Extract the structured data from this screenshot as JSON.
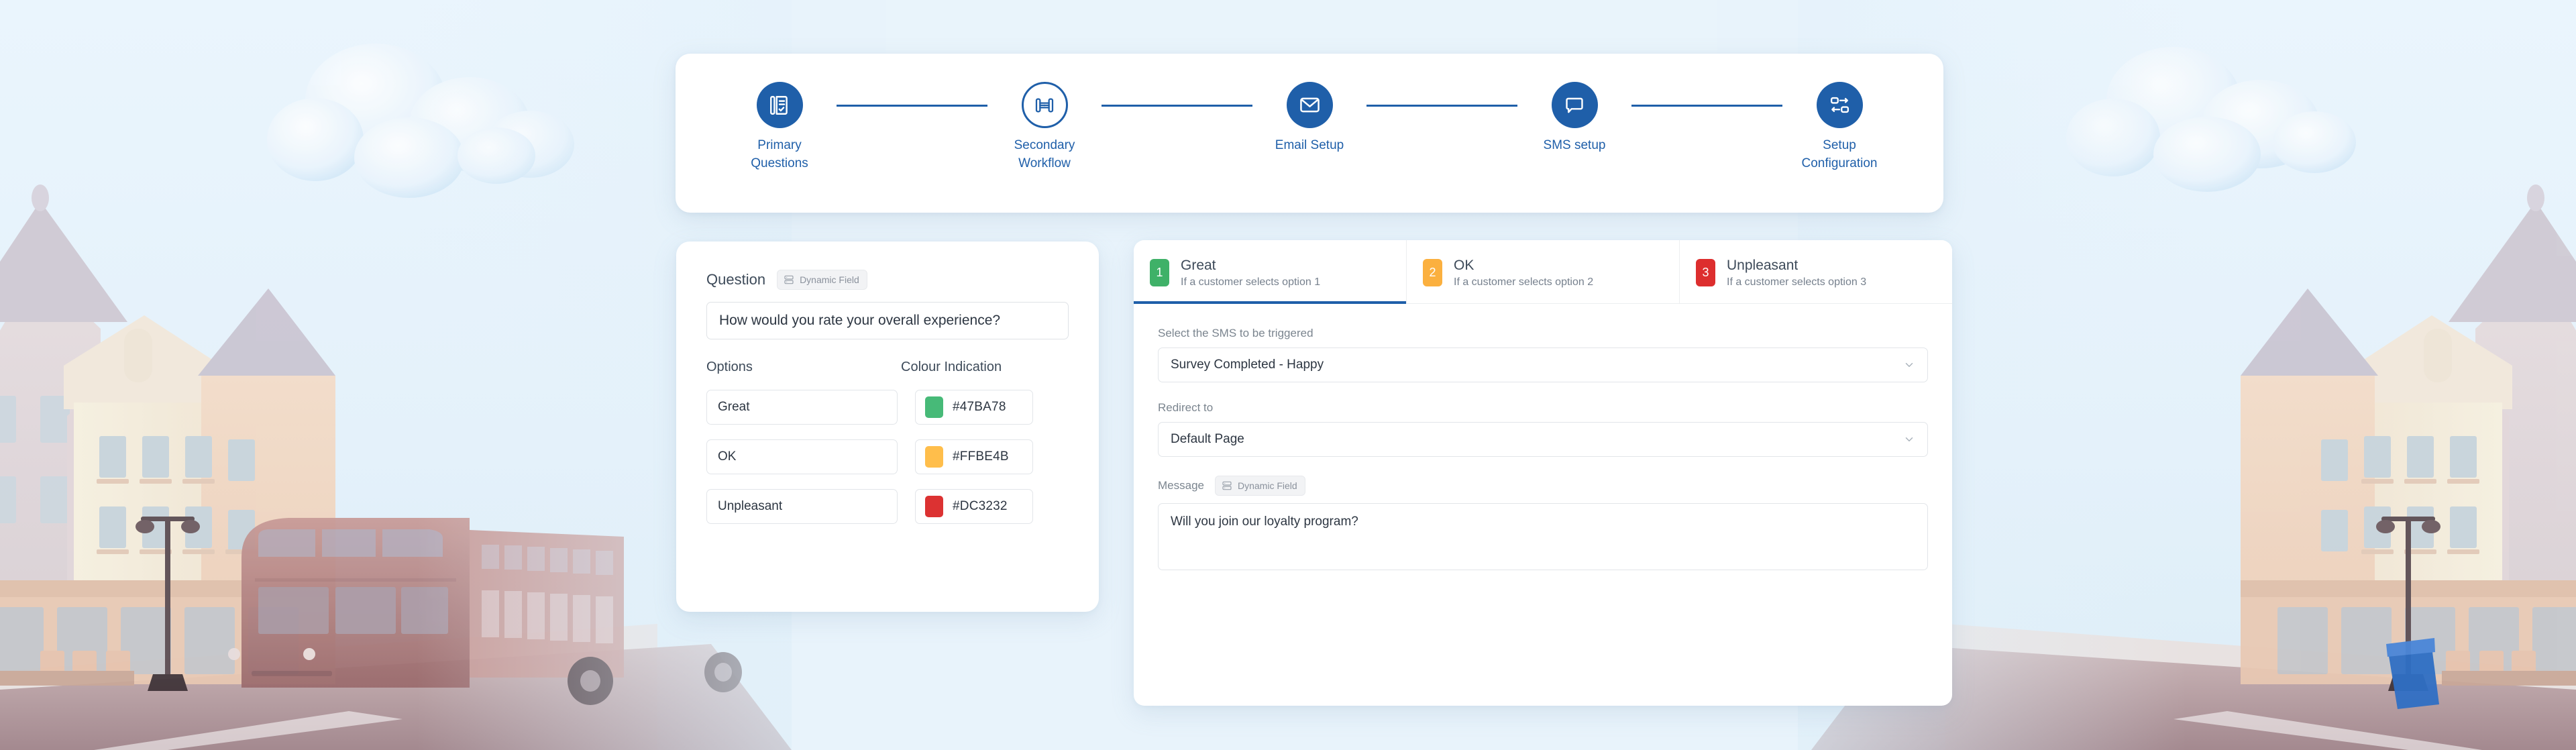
{
  "stepper": {
    "steps": [
      {
        "label": "Primary\nQuestions",
        "icon": "clipboard-check-icon",
        "state": "filled"
      },
      {
        "label": "Secondary\nWorkflow",
        "icon": "workflow-node-icon",
        "state": "hollow"
      },
      {
        "label": "Email Setup",
        "icon": "envelope-icon",
        "state": "filled"
      },
      {
        "label": "SMS setup",
        "icon": "chat-bubble-icon",
        "state": "filled"
      },
      {
        "label": "Setup\nConfiguration",
        "icon": "config-nodes-icon",
        "state": "filled"
      }
    ],
    "accent_color": "#1F5FA9"
  },
  "question_panel": {
    "question_label": "Question",
    "dynamic_field_badge": "Dynamic Field",
    "question_value": "How would you rate your overall experience?",
    "options_header": "Options",
    "colour_header": "Colour Indication",
    "rows": [
      {
        "option": "Great",
        "hex": "#47BA78"
      },
      {
        "option": "OK",
        "hex": "#FFBE4B"
      },
      {
        "option": "Unpleasant",
        "hex": "#DC3232"
      }
    ]
  },
  "sms_panel": {
    "tabs": [
      {
        "num": "1",
        "title": "Great",
        "subtitle": "If a customer selects option 1",
        "color": "#3FB168",
        "active": true
      },
      {
        "num": "2",
        "title": "OK",
        "subtitle": "If a customer selects option 2",
        "color": "#FBB03F",
        "active": false
      },
      {
        "num": "3",
        "title": "Unpleasant",
        "subtitle": "If a customer selects option 3",
        "color": "#DD2E2E",
        "active": false
      }
    ],
    "sms_select_label": "Select the SMS to be triggered",
    "sms_select_value": "Survey Completed - Happy",
    "redirect_label": "Redirect to",
    "redirect_value": "Default Page",
    "message_label": "Message",
    "message_badge": "Dynamic Field",
    "message_value": "Will you join our loyalty program?"
  }
}
